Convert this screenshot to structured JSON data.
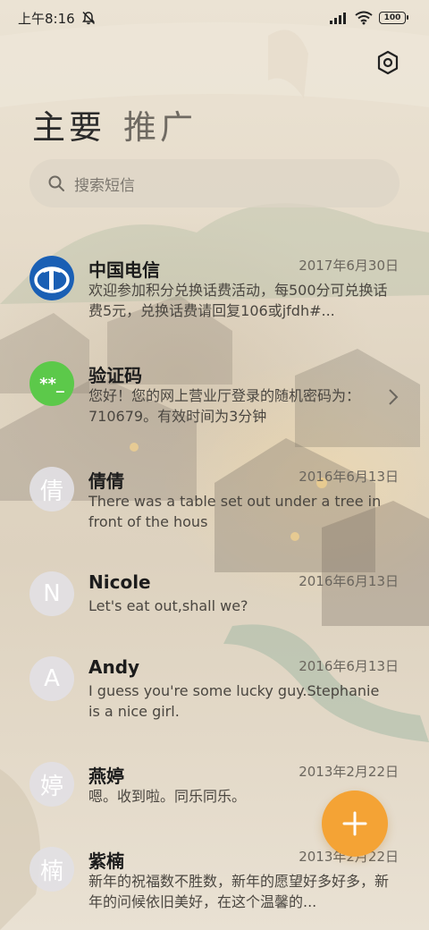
{
  "status_bar": {
    "time": "上午8:16",
    "battery": "100",
    "icons": [
      "mute-icon",
      "signal-icon",
      "wifi-icon",
      "battery-icon"
    ]
  },
  "tabs": [
    {
      "label": "主要",
      "active": true
    },
    {
      "label": "推广",
      "active": false
    }
  ],
  "search": {
    "placeholder": "搜索短信"
  },
  "messages": [
    {
      "name": "中国电信",
      "date": "2017年6月30日",
      "preview": "欢迎参加积分兑换话费活动，每500分可兑换话费5元，兑换话费请回复106或jfdh#...",
      "avatar": "china-telecom-logo",
      "avatar_text": ""
    },
    {
      "name": "验证码",
      "date": "",
      "preview": "您好！您的网上营业厅登录的随机密码为：710679。有效时间为3分钟",
      "avatar": "verification-code-icon",
      "avatar_text": "**_"
    },
    {
      "name": "倩倩",
      "date": "2016年6月13日",
      "preview": "There was a table set out under a tree in front of the hous",
      "avatar": "letter",
      "avatar_text": "倩"
    },
    {
      "name": "Nicole",
      "date": "2016年6月13日",
      "preview": "Let's eat out,shall we?",
      "avatar": "letter",
      "avatar_text": "N"
    },
    {
      "name": "Andy",
      "date": "2016年6月13日",
      "preview": "I guess you're some lucky guy.Stephanie is a nice girl.",
      "avatar": "letter",
      "avatar_text": "A"
    },
    {
      "name": "燕婷",
      "date": "2013年2月22日",
      "preview": "嗯。收到啦。同乐同乐。",
      "avatar": "letter",
      "avatar_text": "婷"
    },
    {
      "name": "紫楠",
      "date": "2013年2月22日",
      "preview": "新年的祝福数不胜数，新年的愿望好多好多，新年的问候依旧美好，在这个温馨的...",
      "avatar": "letter",
      "avatar_text": "楠"
    }
  ],
  "colors": {
    "fab": "#f4a335",
    "verification_avatar": "#5cc94a",
    "telecom_blue": "#1a5fb4"
  },
  "fab": {
    "icon": "plus-icon"
  }
}
